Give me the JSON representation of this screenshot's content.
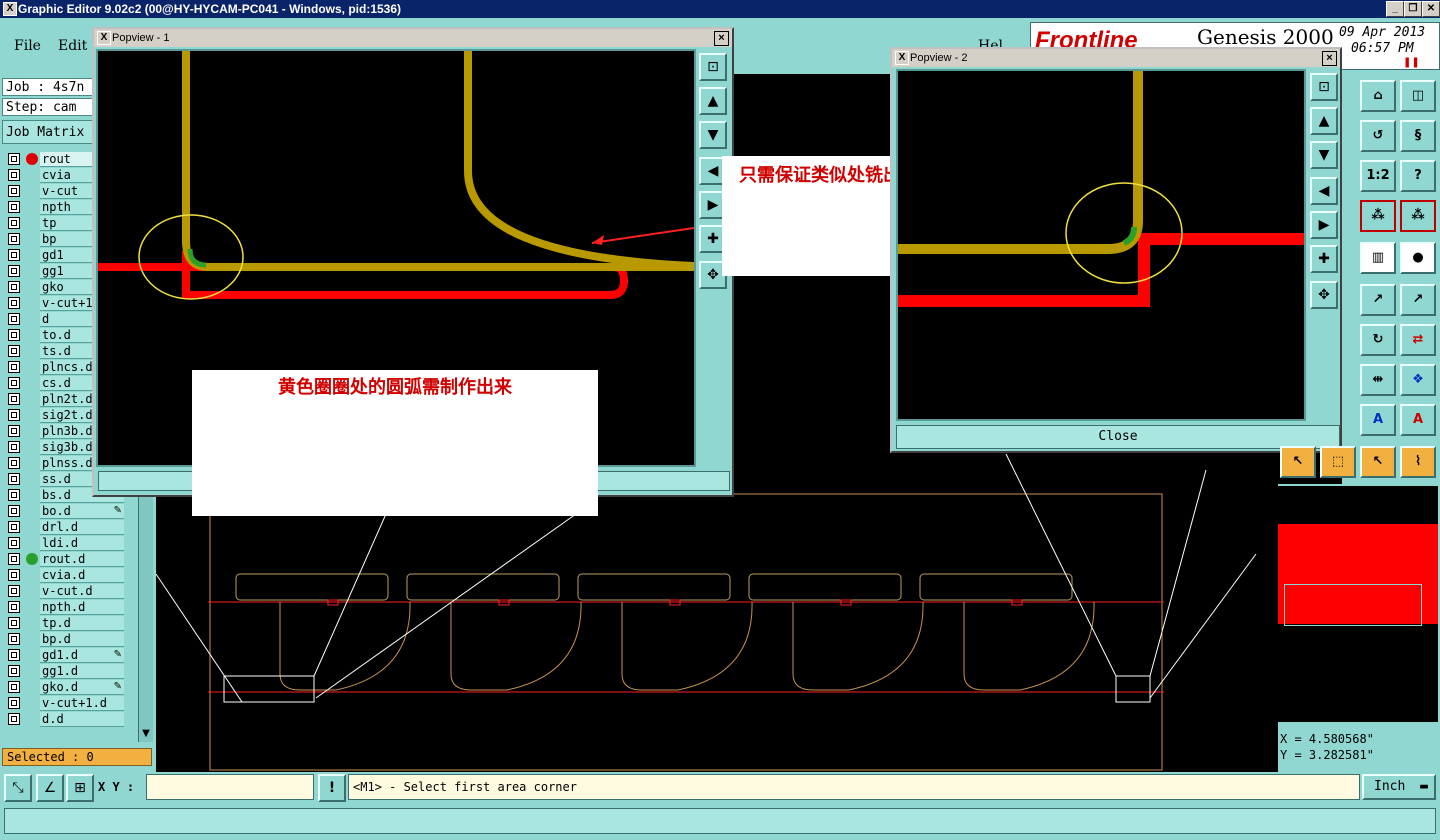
{
  "window": {
    "title": "Graphic Editor 9.02c2 (00@HY-HYCAM-PC041 - Windows, pid:1536)",
    "minimize": "_",
    "restore": "❐",
    "close": "✕"
  },
  "menu": {
    "file": "File",
    "edit": "Edit",
    "help_partial": "Hel"
  },
  "brand": {
    "logo": "Frontline",
    "product": "Genesis 2000",
    "date": "09 Apr 2013",
    "time": "06:57 PM",
    "pause": "❚❚"
  },
  "info": {
    "job": "Job : 4s7n",
    "step": "Step: cam",
    "matrix_button": "Job Matrix"
  },
  "layers": [
    {
      "name": "rout",
      "active": true,
      "dot": "#e00000"
    },
    {
      "name": "cvia"
    },
    {
      "name": "v-cut"
    },
    {
      "name": "npth"
    },
    {
      "name": "tp"
    },
    {
      "name": "bp"
    },
    {
      "name": "gd1"
    },
    {
      "name": "gg1"
    },
    {
      "name": "gko"
    },
    {
      "name": "v-cut+1"
    },
    {
      "name": "d"
    },
    {
      "name": "to.d"
    },
    {
      "name": "ts.d"
    },
    {
      "name": "plncs.d"
    },
    {
      "name": "cs.d"
    },
    {
      "name": "pln2t.d"
    },
    {
      "name": "sig2t.d"
    },
    {
      "name": "pln3b.d"
    },
    {
      "name": "sig3b.d"
    },
    {
      "name": "plnss.d"
    },
    {
      "name": "ss.d"
    },
    {
      "name": "bs.d"
    },
    {
      "name": "bo.d",
      "mark": "✎"
    },
    {
      "name": "drl.d"
    },
    {
      "name": "ldi.d"
    },
    {
      "name": "rout.d",
      "dot": "#2aa02a"
    },
    {
      "name": "cvia.d"
    },
    {
      "name": "v-cut.d"
    },
    {
      "name": "npth.d"
    },
    {
      "name": "tp.d"
    },
    {
      "name": "bp.d"
    },
    {
      "name": "gd1.d",
      "mark": "✎"
    },
    {
      "name": "gg1.d"
    },
    {
      "name": "gko.d",
      "mark": "✎"
    },
    {
      "name": "v-cut+1.d"
    },
    {
      "name": "d.d"
    }
  ],
  "selected": "Selected : 0",
  "popview1": {
    "title": "Popview - 1",
    "close": "×",
    "note_right": "只需保证类似处铣出即可",
    "note_bottom": "黄色圈圈处的圆弧需制作出来"
  },
  "popview2": {
    "title": "Popview - 2",
    "close": "×",
    "close_button": "Close"
  },
  "coords": {
    "x": "X = 4.580568\"",
    "y": "Y = 3.282581\""
  },
  "bottom": {
    "xy_label": "X Y :",
    "xy_value": "",
    "prompt": "<M1> - Select first area corner",
    "units": "Inch",
    "excl": "!"
  },
  "colors": {
    "background": "#000000",
    "panel": "#8fd7d0",
    "route_red": "#ff0000",
    "trace_yellow": "#b89a00",
    "circle": "#f0e040"
  }
}
